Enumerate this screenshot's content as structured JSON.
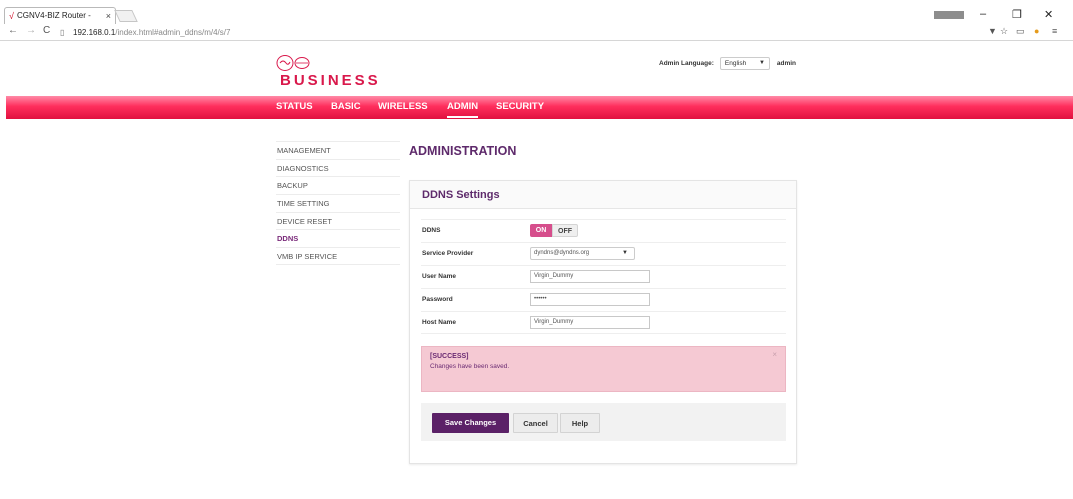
{
  "browser": {
    "tab_title": "CGNV4-BIZ Router -",
    "tab_close": "×",
    "window_user": "",
    "url_host": "192.168.0.1",
    "url_path": "/index.html#admin_ddns/m/4/s/7"
  },
  "header": {
    "brand": "BUSINESS",
    "language_label": "Admin Language:",
    "language_value": "English",
    "username": "admin"
  },
  "menu": {
    "items": [
      {
        "label": "STATUS"
      },
      {
        "label": "BASIC"
      },
      {
        "label": "WIRELESS"
      },
      {
        "label": "ADMIN"
      },
      {
        "label": "SECURITY"
      }
    ],
    "active": "ADMIN"
  },
  "sidebar": {
    "items": [
      {
        "label": "MANAGEMENT"
      },
      {
        "label": "DIAGNOSTICS"
      },
      {
        "label": "BACKUP"
      },
      {
        "label": "TIME SETTING"
      },
      {
        "label": "DEVICE RESET"
      },
      {
        "label": "DDNS"
      },
      {
        "label": "VMB IP SERVICE"
      }
    ],
    "active": "DDNS"
  },
  "main": {
    "title": "ADMINISTRATION",
    "panel_title": "DDNS Settings",
    "form": {
      "ddns_label": "DDNS",
      "ddns_on": "ON",
      "ddns_off": "OFF",
      "ddns_state": "ON",
      "provider_label": "Service Provider",
      "provider_value": "dyndns@dyndns.org",
      "username_label": "User Name",
      "username_value": "Virgin_Dummy",
      "password_label": "Password",
      "password_value": "••••••",
      "hostname_label": "Host Name",
      "hostname_value": "Virgin_Dummy"
    },
    "alert": {
      "title": "[SUCCESS]",
      "message": "Changes have been saved.",
      "close": "×"
    },
    "buttons": {
      "save": "Save Changes",
      "cancel": "Cancel",
      "help": "Help"
    }
  },
  "colors": {
    "brand_red": "#d9184b",
    "menu_bar": "#ff2e5c",
    "accent_purple": "#5e2a6b",
    "toggle_on": "#d64e8c",
    "alert_bg": "#f5c9d3"
  }
}
